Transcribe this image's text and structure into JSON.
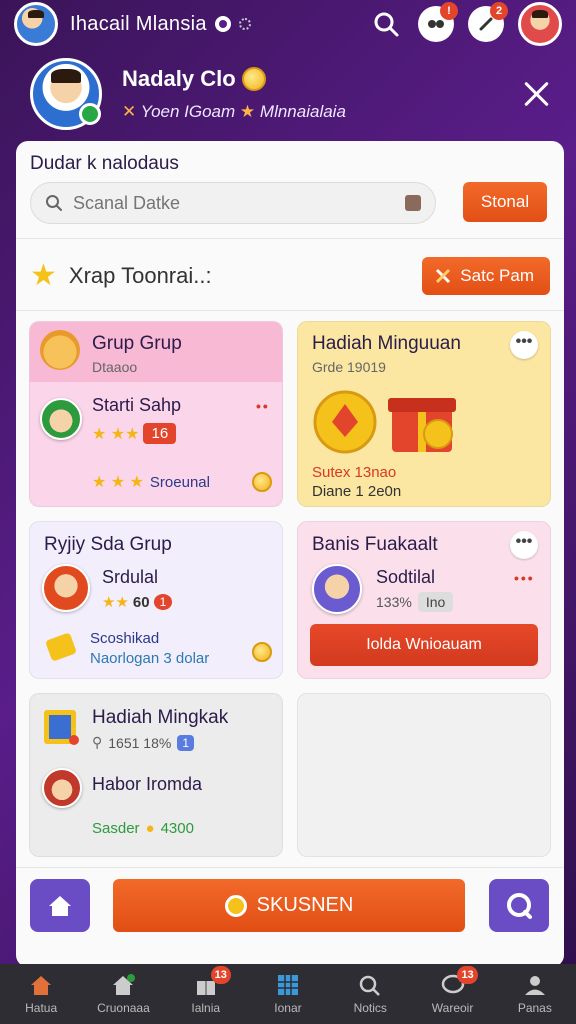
{
  "topbar": {
    "title": "Ihacail Mlansia",
    "notif_badge": "!",
    "alert_badge": "2"
  },
  "profile": {
    "name": "Nadaly Clo",
    "subtitle_a": "Yoen IGoam",
    "subtitle_b": "Mlnnaialaia"
  },
  "search": {
    "title": "Dudar k nalodaus",
    "placeholder": "Scanal Datke",
    "button": "Stonal"
  },
  "section": {
    "label": "Xrap Toonrai..:",
    "button": "Satc Pam"
  },
  "tiles": {
    "t1": {
      "title": "Grup Grup",
      "sub": "Dtaaoo",
      "name": "Starti Sahp",
      "level": "16",
      "footer": "Sroeunal"
    },
    "t2": {
      "title": "Hadiah Minguuan",
      "sub": "Grde 19019",
      "line1": "Sutex 13nao",
      "line2": "Diane 1 2e0n"
    },
    "t3": {
      "title": "Ryjiy Sda Grup",
      "name": "Srdulal",
      "score": "60",
      "badge": "1",
      "desc1": "Scoshikad",
      "desc2": "Naorlogan 3 dolar"
    },
    "t4": {
      "title": "Banis Fuakaalt",
      "name": "Sodtilal",
      "pct": "133%",
      "tag": "Ino",
      "button": "Iolda Wnioauam"
    },
    "t5": {
      "title": "Hadiah Mingkak",
      "meta": "1651 18%",
      "meta_badge": "1",
      "name": "Habor Iromda",
      "reward": "Sasder",
      "reward_val": "4300"
    }
  },
  "actions": {
    "main_button": "SKUSNEN"
  },
  "nav": {
    "items": [
      {
        "label": "Hatua",
        "badge": ""
      },
      {
        "label": "Cruonaaa",
        "badge": ""
      },
      {
        "label": "Ialnia",
        "badge": "13"
      },
      {
        "label": "Ionar",
        "badge": ""
      },
      {
        "label": "Notics",
        "badge": ""
      },
      {
        "label": "Wareoir",
        "badge": "13"
      },
      {
        "label": "Panas",
        "badge": ""
      }
    ]
  },
  "colors": {
    "accent_orange": "#e24f15",
    "purple_bg": "#5a1d8a",
    "tile_pink": "#fbd1e8",
    "tile_yellow": "#fbe8a6",
    "tile_lilac": "#f3eefb",
    "tile_rose": "#fbe4ef",
    "tile_grey": "#ececec"
  }
}
